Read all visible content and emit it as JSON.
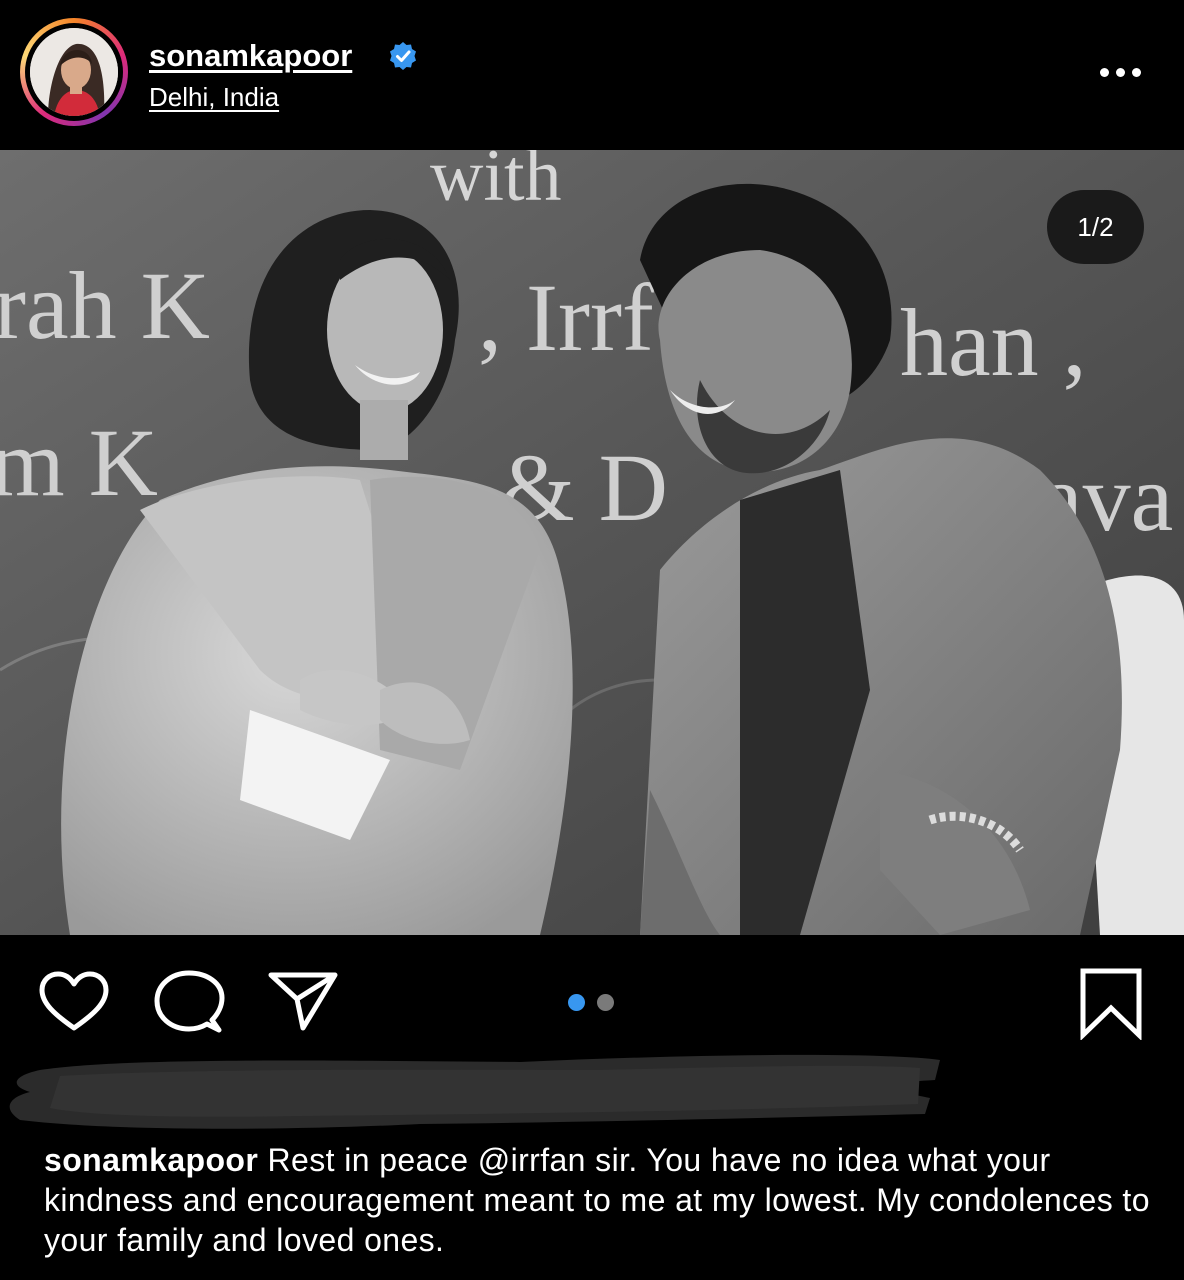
{
  "post": {
    "username": "sonamkapoor",
    "location": "Delhi, India",
    "carousel_counter": "1/2",
    "carousel_total": 2,
    "carousel_active_index": 0
  },
  "photo": {
    "banner_line1": "with",
    "banner_line2a": "rah K",
    "banner_line2b": ", Irrf",
    "banner_line2c": "han ,",
    "banner_line3a": "m K",
    "banner_line3b": "& D",
    "banner_line3c": "ava"
  },
  "caption": {
    "username": "sonamkapoor",
    "text_before_mention": " Rest in peace ",
    "mention": "@irrfan",
    "text_after_mention": " sir. You have no idea what your kindness and encouragement meant to me at my lowest. My condolences to your family and loved ones."
  },
  "icons": {
    "like": "heart-icon",
    "comment": "comment-icon",
    "share": "send-icon",
    "save": "bookmark-icon",
    "more": "more-icon",
    "verified": "verified-badge-icon"
  },
  "colors": {
    "background": "#000000",
    "verified_blue": "#3897f0",
    "active_dot": "#3897f0",
    "inactive_dot": "#7a7a7a",
    "mention": "#ffffff"
  }
}
